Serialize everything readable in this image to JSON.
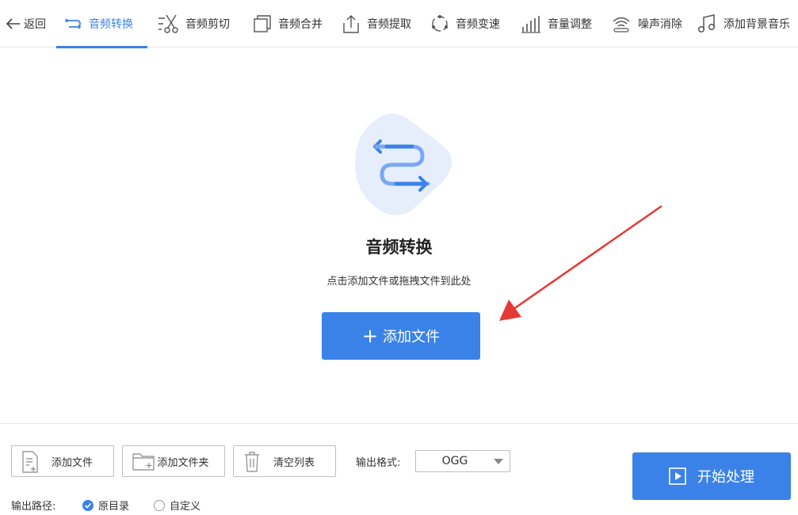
{
  "topbar": {
    "back_label": "返回",
    "tabs": [
      {
        "label": "音频转换",
        "icon": "convert-arrows-icon",
        "active": true
      },
      {
        "label": "音频剪切",
        "icon": "scissors-icon",
        "active": false
      },
      {
        "label": "音频合并",
        "icon": "merge-squares-icon",
        "active": false
      },
      {
        "label": "音频提取",
        "icon": "upload-tray-icon",
        "active": false
      },
      {
        "label": "音频变速",
        "icon": "speed-circle-icon",
        "active": false
      },
      {
        "label": "音量调整",
        "icon": "volume-bars-icon",
        "active": false
      },
      {
        "label": "噪声消除",
        "icon": "noise-wave-icon",
        "active": false
      },
      {
        "label": "添加背景音乐",
        "icon": "music-note-icon",
        "active": false
      }
    ]
  },
  "main": {
    "title": "音频转换",
    "subtitle": "点击添加文件或拖拽文件到此处",
    "add_button": "添加文件",
    "add_button_icon": "plus-icon"
  },
  "bottom": {
    "add_file": "添加文件",
    "add_folder": "添加文件夹",
    "clear_list": "清空列表",
    "format_label": "输出格式:",
    "format_value": "OGG",
    "path_label": "输出路径:",
    "path_options": [
      {
        "label": "原目录",
        "checked": true
      },
      {
        "label": "自定义",
        "checked": false
      }
    ],
    "start_button": "开始处理"
  },
  "colors": {
    "accent": "#3b82e8",
    "arrow": "#e53935",
    "hero_bg": "#e6eefb"
  }
}
